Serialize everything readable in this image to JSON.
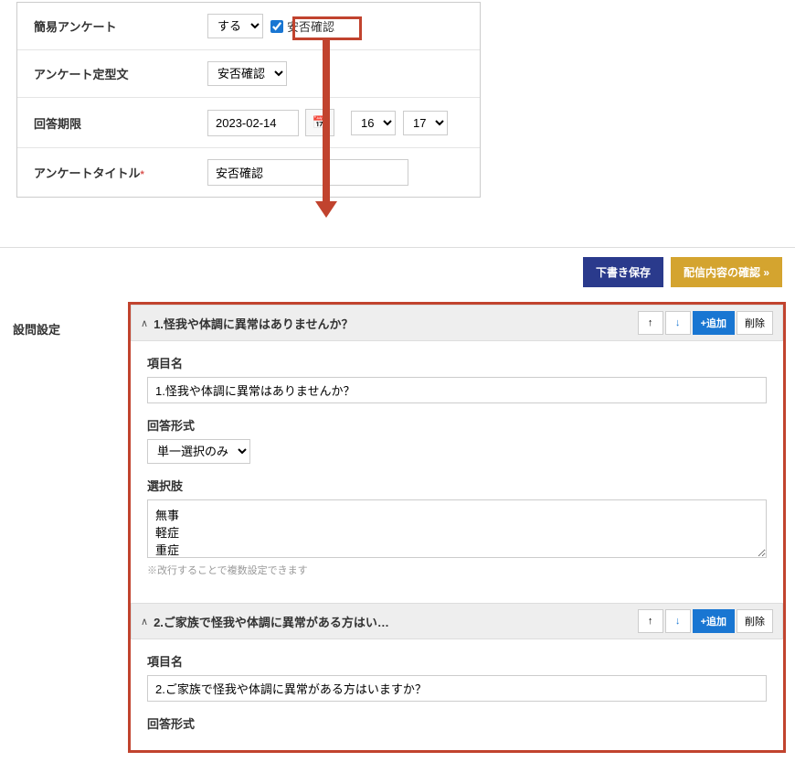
{
  "top_form": {
    "simple_survey": {
      "label": "簡易アンケート",
      "select_value": "する",
      "checkbox_label": "安否確認"
    },
    "template": {
      "label": "アンケート定型文",
      "select_value": "安否確認"
    },
    "deadline": {
      "label": "回答期限",
      "date": "2023-02-14",
      "hour": "16",
      "minute": "17"
    },
    "title": {
      "label": "アンケートタイトル",
      "required_mark": "*",
      "value": "安否確認"
    }
  },
  "buttons": {
    "save_draft": "下書き保存",
    "confirm": "配信内容の確認 »"
  },
  "settings_label": "設問設定",
  "questions": [
    {
      "header": "1.怪我や体調に異常はありませんか？",
      "item_name_label": "項目名",
      "item_name_value": "1.怪我や体調に異常はありませんか？",
      "answer_format_label": "回答形式",
      "answer_format_value": "単一選択のみ",
      "choices_label": "選択肢",
      "choices_value": "無事\n軽症\n重症",
      "hint": "※改行することで複数設定できます"
    },
    {
      "header": "2.ご家族で怪我や体調に異常がある方はい…",
      "item_name_label": "項目名",
      "item_name_value": "2.ご家族で怪我や体調に異常がある方はいますか？",
      "answer_format_label": "回答形式"
    }
  ],
  "q_actions": {
    "up": "↑",
    "down": "↓",
    "add": "+追加",
    "delete": "削除"
  },
  "icons": {
    "calendar": "📅"
  }
}
